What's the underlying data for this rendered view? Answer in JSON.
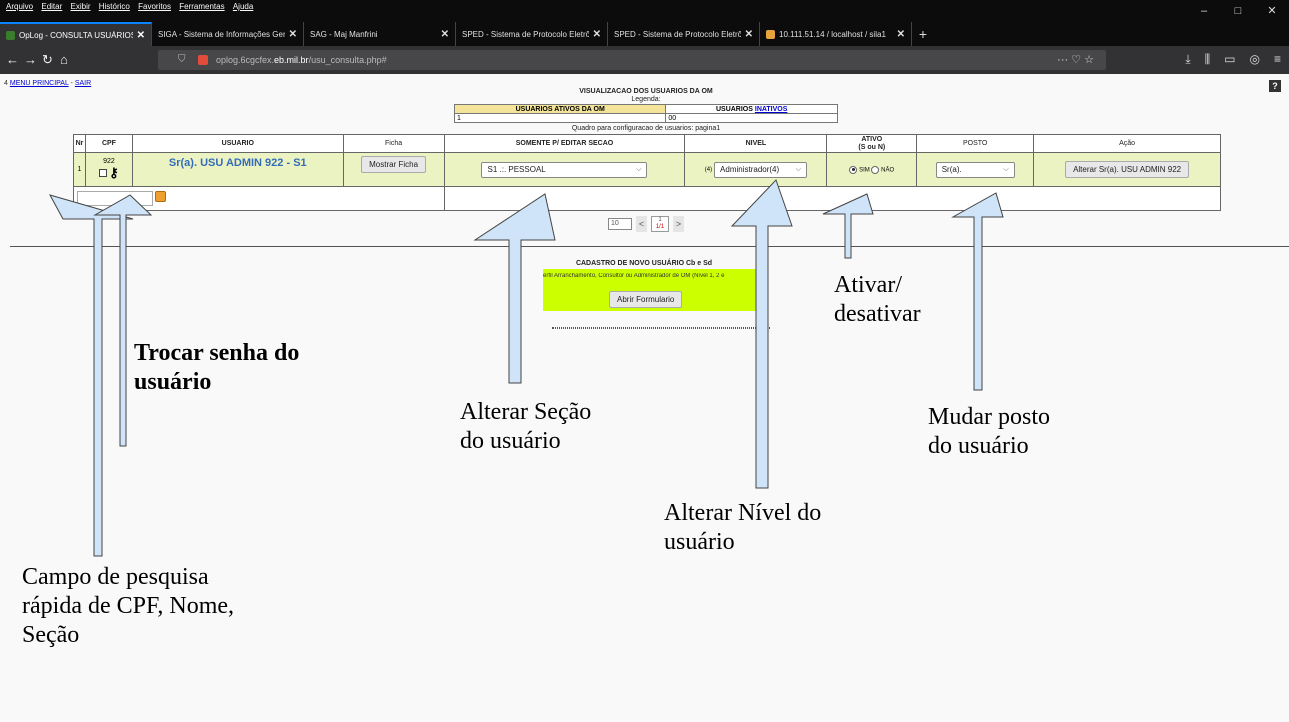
{
  "browser": {
    "menu": [
      "Arquivo",
      "Editar",
      "Exibir",
      "Histórico",
      "Favoritos",
      "Ferramentas",
      "Ajuda"
    ],
    "window_controls": [
      "–",
      "□",
      "✕"
    ],
    "tabs": [
      {
        "title": "OpLog - CONSULTA USUÁRIOS"
      },
      {
        "title": "SIGA - Sistema de Informações Ger"
      },
      {
        "title": "SAG - Maj Manfrini"
      },
      {
        "title": "SPED - Sistema de Protocolo Eletrô"
      },
      {
        "title": "SPED - Sistema de Protocolo Eletrô"
      },
      {
        "title": "10.111.51.14 / localhost / sila1"
      }
    ],
    "new_tab": "+",
    "url_prefix": "oplog.6cgcfex.",
    "url_domain": "eb.mil.br",
    "url_path": "/usu_consulta.php#",
    "url_actions": "··· ♡ ☆"
  },
  "page": {
    "nav_prefix": "4",
    "nav_menu": "MENU PRINCIPAL",
    "nav_sep": "-",
    "nav_exit": "SAIR",
    "help": "?",
    "title": "VISUALIZACAO DOS USUARIOS DA OM",
    "legend_label": "Legenda:",
    "legend": {
      "active_header": "USUARIOS ATIVOS DA OM",
      "inactive_prefix": "USUARIOS ",
      "inactive_link": "INATIVOS",
      "active_count": "1",
      "inactive_count": "00"
    },
    "config_caption": "Quadro para configuracao de usuarios: pagina1",
    "table": {
      "headers": [
        "Nr",
        "CPF",
        "USUARIO",
        "Ficha",
        "SOMENTE P/ EDITAR SECAO",
        "NIVEL",
        "ATIVO",
        "(S ou N)",
        "POSTO",
        "Ação"
      ],
      "row": {
        "nr": "1",
        "cpf": "922",
        "usuario": "Sr(a). USU ADMIN 922 - S1",
        "ficha_button": "Mostrar Ficha",
        "secao": "S1 .:. PESSOAL",
        "nivel_prefix": "(4)",
        "nivel": "Administrador(4)",
        "ativo_sim": "SIM",
        "ativo_nao": "NÃO",
        "posto": "Sr(a).",
        "acao_button": "Alterar Sr(a). USU ADMIN 922"
      }
    },
    "pager": {
      "per_page": "10",
      "prev": "<",
      "next": ">",
      "page": "1",
      "total": "1/1"
    },
    "cadastro": {
      "title": "CADASTRO DE NOVO USUÁRIO Cb e Sd",
      "text": "erfil Arranchamento, Consultor ou Administrador de OM (Nível 1, 2 e",
      "button": "Abrir Formulario"
    }
  },
  "annotations": {
    "pesquisa": [
      "Campo de pesquisa",
      "rápida de CPF, Nome,",
      "Seção"
    ],
    "senha": [
      "Trocar senha do",
      "usuário"
    ],
    "secao": [
      "Alterar Seção",
      "do usuário"
    ],
    "nivel": [
      "Alterar Nível do",
      "usuário"
    ],
    "ativar": [
      "Ativar/",
      "desativar"
    ],
    "posto": [
      "Mudar posto",
      "do usuário"
    ]
  },
  "colors": {
    "row_bg": "#ecf3c3",
    "cadastro_bg": "#ccff00",
    "arrow_fill": "#cfe4f8",
    "link": "#0000cc",
    "user_name": "#336dba"
  }
}
